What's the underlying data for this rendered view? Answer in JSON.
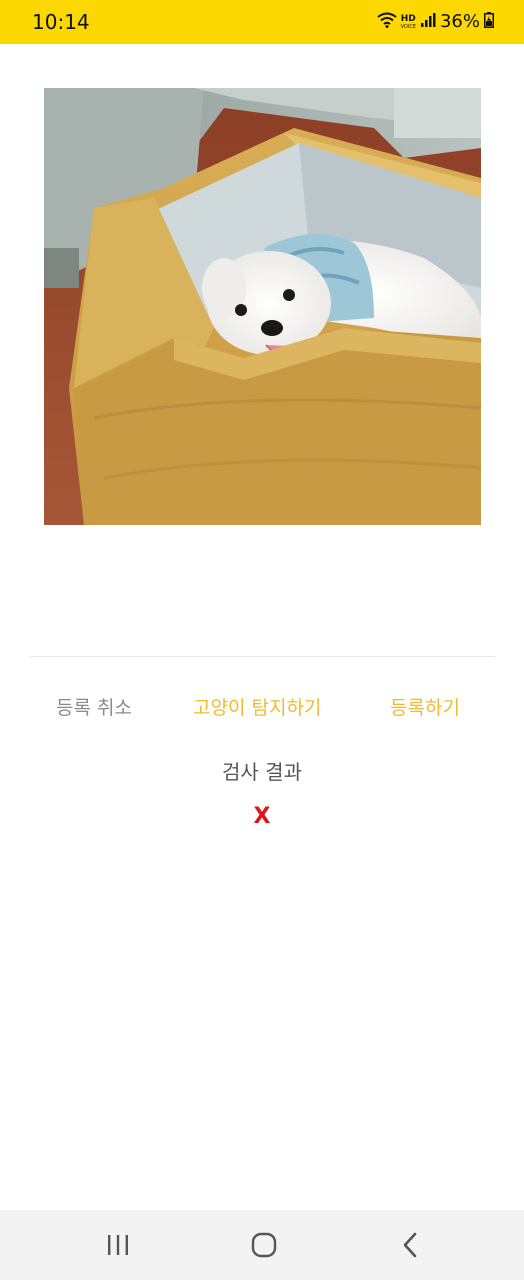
{
  "status_bar": {
    "time": "10:14",
    "hd_label": "HD",
    "voice_label": "VOICE",
    "battery_percent": "36%",
    "icons": [
      "wifi-icon",
      "hd-voice-icon",
      "signal-icon",
      "battery-icon"
    ],
    "background_color": "#fcd700"
  },
  "photo": {
    "subject": "dog-in-bed-photo"
  },
  "actions": {
    "cancel_label": "등록 취소",
    "detect_label": "고양이 탐지하기",
    "register_label": "등록하기",
    "accent_color": "#f2bb2f",
    "muted_color": "#8a8a8a"
  },
  "result": {
    "label": "검사 결과",
    "value": "X",
    "value_color": "#e0141b"
  },
  "nav_bar": {
    "icons": [
      "recent-apps-icon",
      "home-icon",
      "back-icon"
    ]
  }
}
